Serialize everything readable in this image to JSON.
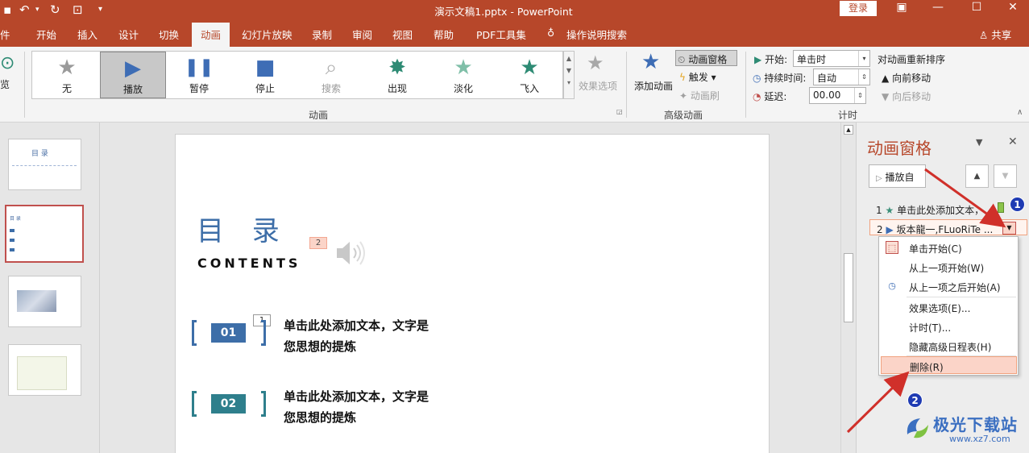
{
  "titlebar": {
    "title": "演示文稿1.pptx - PowerPoint",
    "login": "登录"
  },
  "tabs": [
    "件",
    "开始",
    "插入",
    "设计",
    "切换",
    "动画",
    "幻灯片放映",
    "录制",
    "审阅",
    "视图",
    "帮助",
    "PDF工具集",
    "操作说明搜索"
  ],
  "share": "共享",
  "ribbon": {
    "preview_label": "览",
    "effects": [
      {
        "label": "无",
        "icon": "★",
        "color": "#9a9a9a",
        "dim": false
      },
      {
        "label": "播放",
        "icon": "▶",
        "color": "#3e6db5",
        "dim": false
      },
      {
        "label": "暂停",
        "icon": "❚❚",
        "color": "#3e6db5",
        "dim": false
      },
      {
        "label": "停止",
        "icon": "■",
        "color": "#3e6db5",
        "dim": false
      },
      {
        "label": "搜索",
        "icon": "⌕",
        "color": "#b0b0b0",
        "dim": true
      },
      {
        "label": "出现",
        "icon": "✸",
        "color": "#2e8b74",
        "dim": false
      },
      {
        "label": "淡化",
        "icon": "★",
        "color": "#7fbfa8",
        "dim": false
      },
      {
        "label": "飞入",
        "icon": "★",
        "color": "#2e8b74",
        "dim": false
      }
    ],
    "effect_options": "效果选项",
    "group_animation": "动画",
    "add_animation": "添加动画",
    "animation_pane": "动画窗格",
    "trigger": "触发",
    "painter": "动画刷",
    "group_advanced": "高级动画",
    "start_label": "开始:",
    "start_value": "单击时",
    "duration_label": "持续时间:",
    "duration_value": "自动",
    "delay_label": "延迟:",
    "delay_value": "00.00",
    "group_timing": "计时",
    "reorder_title": "对动画重新排序",
    "move_earlier": "向前移动",
    "move_later": "向后移动"
  },
  "thumbnails": [
    {
      "label": "目 录"
    },
    {
      "label": "目 录"
    },
    {
      "label": ""
    },
    {
      "label": ""
    }
  ],
  "slide": {
    "title": "目 录",
    "subtitle": "CONTENTS",
    "tag_audio": "2",
    "tag_item1": "1",
    "items": [
      {
        "num": "01",
        "line1": "单击此处添加文本，文字是",
        "line2": "您思想的提炼",
        "color": "#3d6ea8"
      },
      {
        "num": "02",
        "line1": "单击此处添加文本，文字是",
        "line2": "您思想的提炼",
        "color": "#2e7f8c"
      }
    ]
  },
  "pane": {
    "title": "动画窗格",
    "play_from": "播放自",
    "rows": [
      {
        "num": "1",
        "icon": "★",
        "text": "单击此处添加文本，..."
      },
      {
        "num": "2",
        "icon": "▶",
        "text": "坂本龍一,FLuoRiTe ..."
      }
    ]
  },
  "menu": [
    {
      "label": "单击开始(C)",
      "icon": "mouse-icon"
    },
    {
      "label": "从上一项开始(W)",
      "icon": ""
    },
    {
      "label": "从上一项之后开始(A)",
      "icon": "clock-icon"
    },
    {
      "label": "效果选项(E)...",
      "icon": ""
    },
    {
      "label": "计时(T)...",
      "icon": ""
    },
    {
      "label": "隐藏高级日程表(H)",
      "icon": ""
    },
    {
      "label": "删除(R)",
      "icon": ""
    }
  ],
  "badges": [
    "1",
    "2"
  ],
  "watermark": {
    "text": "极光下载站",
    "url": "www.xz7.com"
  },
  "colors": {
    "accent": "#b7472a",
    "arrow": "#d0302a",
    "badge": "#1f3bb3"
  }
}
